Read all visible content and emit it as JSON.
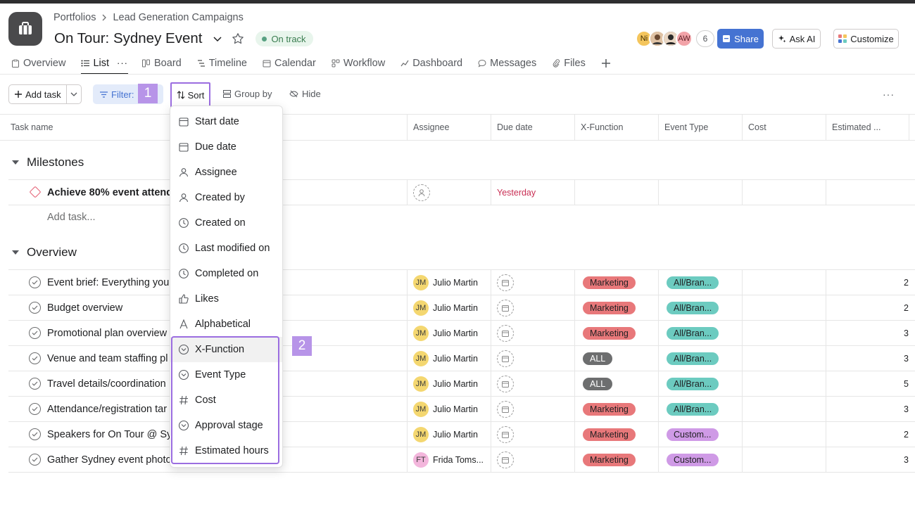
{
  "header": {
    "breadcrumb": [
      "Portfolios",
      "Lead Generation Campaigns"
    ],
    "title": "On Tour: Sydney Event",
    "status": "On track",
    "avatars": [
      "Ni",
      "",
      "",
      "AW"
    ],
    "member_count": "6",
    "share_label": "Share",
    "ask_ai_label": "Ask AI",
    "customize_label": "Customize"
  },
  "tabs": [
    {
      "label": "Overview",
      "icon": "clipboard-icon"
    },
    {
      "label": "List",
      "icon": "list-icon"
    },
    {
      "label": "Board",
      "icon": "board-icon"
    },
    {
      "label": "Timeline",
      "icon": "timeline-icon"
    },
    {
      "label": "Calendar",
      "icon": "calendar-icon"
    },
    {
      "label": "Workflow",
      "icon": "workflow-icon"
    },
    {
      "label": "Dashboard",
      "icon": "dashboard-icon"
    },
    {
      "label": "Messages",
      "icon": "message-icon"
    },
    {
      "label": "Files",
      "icon": "paperclip-icon"
    }
  ],
  "toolbar": {
    "add_task_label": "Add task",
    "filter_label": "Filter:",
    "sort_label": "Sort",
    "group_by_label": "Group by",
    "hide_label": "Hide"
  },
  "callouts": [
    "1",
    "2"
  ],
  "columns": [
    "Task name",
    "Assignee",
    "Due date",
    "X-Function",
    "Event Type",
    "Cost",
    "Estimated ..."
  ],
  "sections": {
    "milestones": {
      "title": "Milestones",
      "task": {
        "name": "Achieve 80% event attend",
        "due": "Yesterday"
      },
      "add_task": "Add task..."
    },
    "overview": {
      "title": "Overview",
      "tasks": [
        {
          "name": "Event brief: Everything you",
          "initials": "JM",
          "assignee": "Julio Martin",
          "xfunction": "Marketing",
          "event_type": "All/Bran...",
          "est": "2"
        },
        {
          "name": "Budget overview",
          "initials": "JM",
          "assignee": "Julio Martin",
          "xfunction": "Marketing",
          "event_type": "All/Bran...",
          "est": "2"
        },
        {
          "name": "Promotional plan overview",
          "initials": "JM",
          "assignee": "Julio Martin",
          "xfunction": "Marketing",
          "event_type": "All/Bran...",
          "est": "3"
        },
        {
          "name": "Venue and team staffing pl",
          "initials": "JM",
          "assignee": "Julio Martin",
          "xfunction": "ALL",
          "event_type": "All/Bran...",
          "est": "3"
        },
        {
          "name": "Travel details/coordination",
          "initials": "JM",
          "assignee": "Julio Martin",
          "xfunction": "ALL",
          "event_type": "All/Bran...",
          "est": "5"
        },
        {
          "name": "Attendance/registration tar",
          "initials": "JM",
          "assignee": "Julio Martin",
          "xfunction": "Marketing",
          "event_type": "All/Bran...",
          "est": "3"
        },
        {
          "name": "Speakers for On Tour @ Sy",
          "initials": "JM",
          "assignee": "Julio Martin",
          "xfunction": "Marketing",
          "event_type": "Custom...",
          "est": "2"
        },
        {
          "name": "Gather Sydney event photo",
          "initials": "FT",
          "assignee": "Frida Toms...",
          "xfunction": "Marketing",
          "event_type": "Custom...",
          "est": "3"
        }
      ]
    }
  },
  "sort_menu": [
    {
      "label": "Start date",
      "icon": "calendar-icon"
    },
    {
      "label": "Due date",
      "icon": "calendar-icon"
    },
    {
      "label": "Assignee",
      "icon": "person-icon"
    },
    {
      "label": "Created by",
      "icon": "person-icon"
    },
    {
      "label": "Created on",
      "icon": "clock-icon"
    },
    {
      "label": "Last modified on",
      "icon": "clock-icon"
    },
    {
      "label": "Completed on",
      "icon": "clock-icon"
    },
    {
      "label": "Likes",
      "icon": "thumbs-up-icon"
    },
    {
      "label": "Alphabetical",
      "icon": "letter-a-icon"
    },
    {
      "label": "X-Function",
      "icon": "dropdown-field-icon"
    },
    {
      "label": "Event Type",
      "icon": "dropdown-field-icon"
    },
    {
      "label": "Cost",
      "icon": "hash-icon"
    },
    {
      "label": "Approval stage",
      "icon": "dropdown-field-icon"
    },
    {
      "label": "Estimated hours",
      "icon": "hash-icon"
    }
  ],
  "colors": {
    "accent": "#4573d2",
    "marketing": "#e8787a",
    "all": "#6d6e6f",
    "brand_pill": "#6ccbc0",
    "custom_pill": "#cf9ae6",
    "callout": "#b794e8",
    "highlight": "#9b6de0",
    "overdue": "#c92f54"
  }
}
